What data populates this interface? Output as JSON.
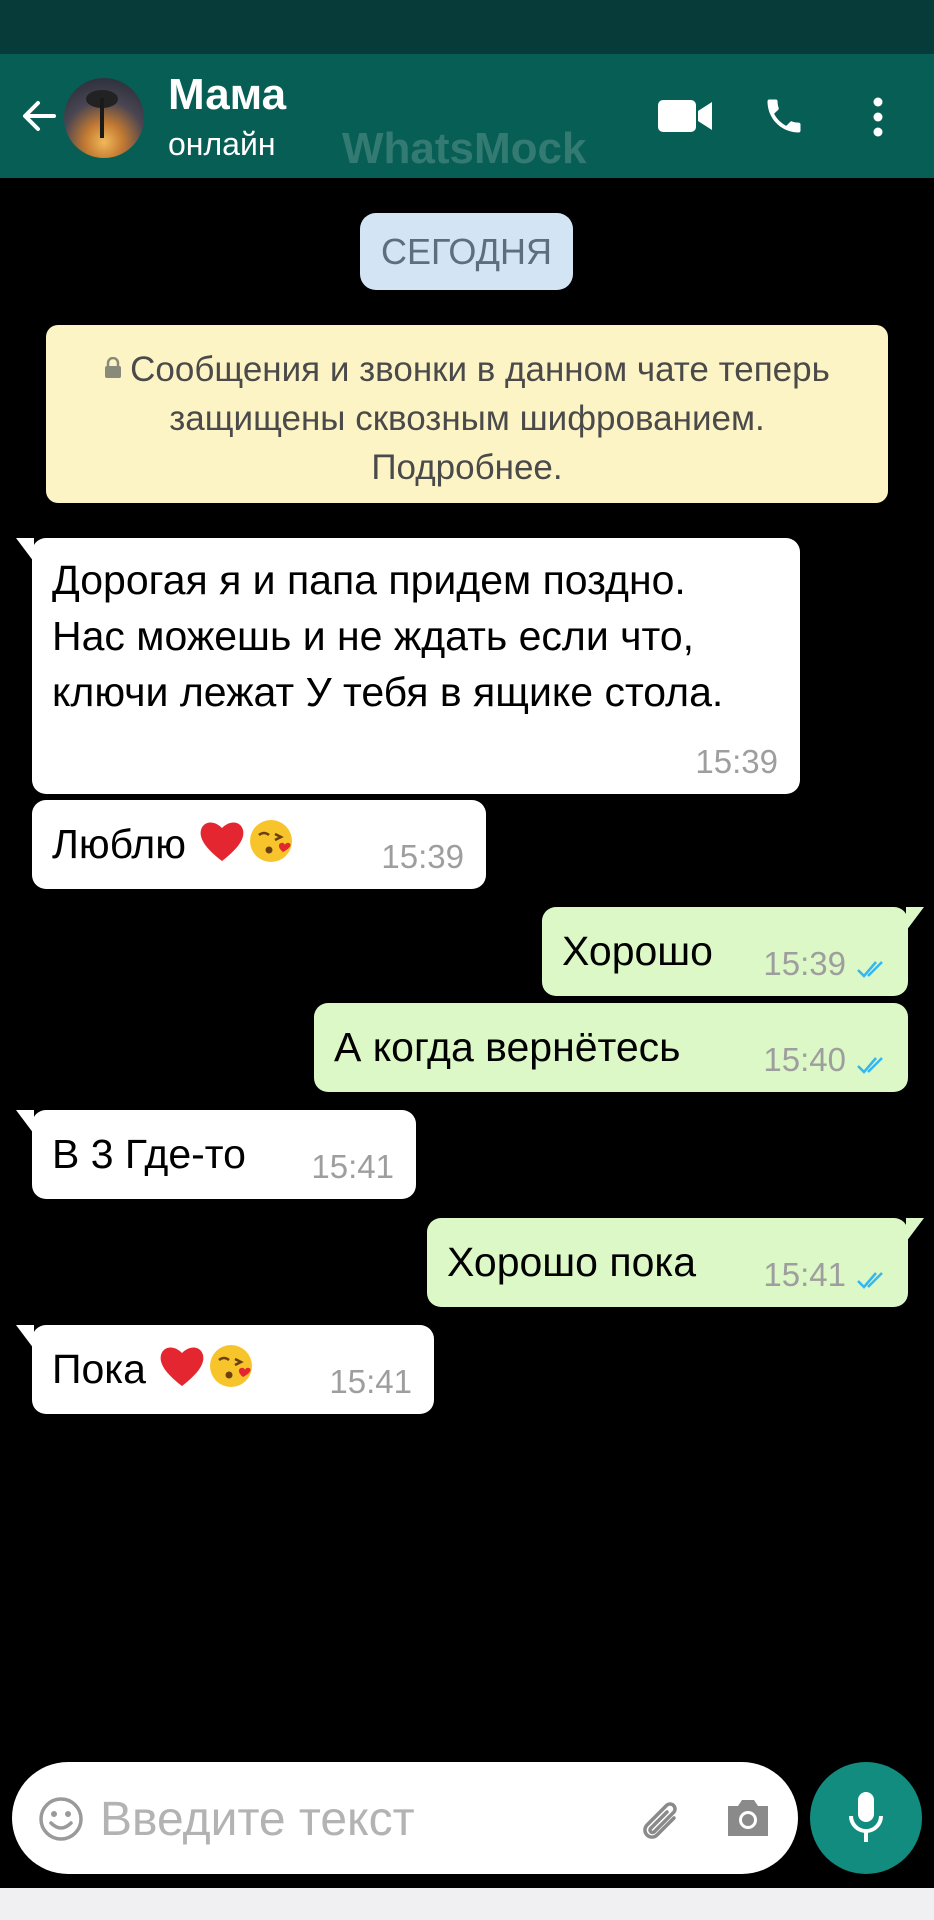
{
  "chat": {
    "contact_name": "Мама",
    "contact_status": "онлайн",
    "watermark": "WhatsMock"
  },
  "date_chip": "СЕГОДНЯ",
  "encryption_notice": "Сообщения и звонки в данном чате теперь защищены сквозным шифрованием. Подробнее.",
  "messages": [
    {
      "direction": "in",
      "text": "Дорогая я и папа придем поздно. Нас можешь и не ждать если что, ключи лежат У тебя в ящике стола.",
      "time": "15:39"
    },
    {
      "direction": "in",
      "text": "Люблю",
      "emojis": [
        "red-heart",
        "face-blowing-kiss"
      ],
      "time": "15:39"
    },
    {
      "direction": "out",
      "text": "Хорошо",
      "time": "15:39",
      "status": "read"
    },
    {
      "direction": "out",
      "text": "А когда вернётесь",
      "time": "15:40",
      "status": "read"
    },
    {
      "direction": "in",
      "text": "В 3 Где-то",
      "time": "15:41"
    },
    {
      "direction": "out",
      "text": "Хорошо пока",
      "time": "15:41",
      "status": "read"
    },
    {
      "direction": "in",
      "text": "Пока",
      "emojis": [
        "red-heart",
        "face-blowing-kiss"
      ],
      "time": "15:41"
    }
  ],
  "composer": {
    "placeholder": "Введите текст"
  },
  "colors": {
    "header": "#075e54",
    "status_bar": "#063b39",
    "chat_background": "#000000",
    "incoming_bubble": "#ffffff",
    "outgoing_bubble": "#dcf8c6",
    "date_chip": "#d3e5f4",
    "notice": "#fdf4c5",
    "read_ticks": "#34b7f1",
    "mic_button": "#128c7e"
  },
  "icons": [
    "back-arrow-icon",
    "video-call-icon",
    "phone-icon",
    "more-vert-icon",
    "lock-icon",
    "emoji-icon",
    "attach-icon",
    "camera-icon",
    "mic-icon",
    "read-ticks-icon"
  ]
}
